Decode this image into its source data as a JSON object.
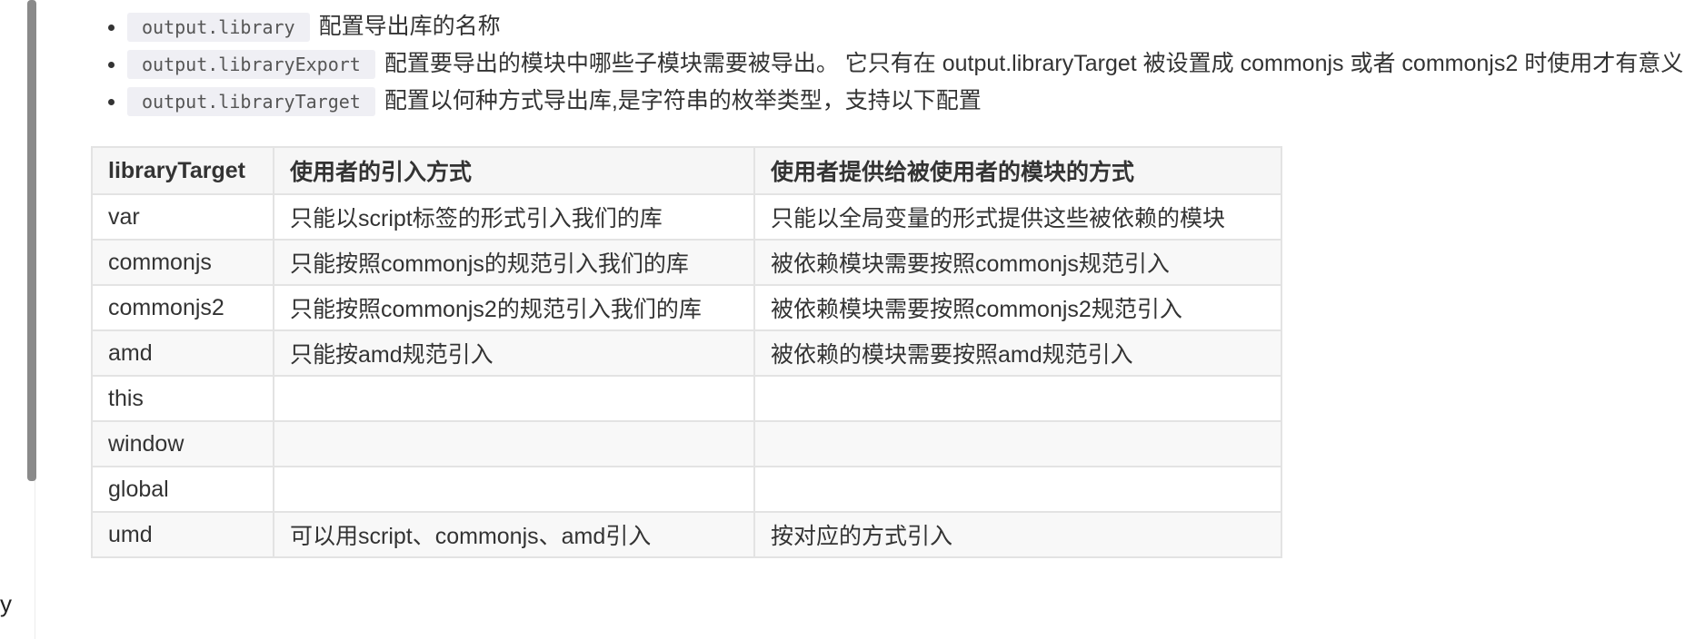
{
  "bullets": [
    {
      "code": "output.library",
      "text": "配置导出库的名称"
    },
    {
      "code": "output.libraryExport",
      "text": "配置要导出的模块中哪些子模块需要被导出。 它只有在 output.libraryTarget 被设置成 commonjs 或者 commonjs2 时使用才有意义"
    },
    {
      "code": "output.libraryTarget",
      "text": "配置以何种方式导出库,是字符串的枚举类型，支持以下配置"
    }
  ],
  "table": {
    "headers": [
      "libraryTarget",
      "使用者的引入方式",
      "使用者提供给被使用者的模块的方式"
    ],
    "rows": [
      [
        "var",
        "只能以script标签的形式引入我们的库",
        "只能以全局变量的形式提供这些被依赖的模块"
      ],
      [
        "commonjs",
        "只能按照commonjs的规范引入我们的库",
        "被依赖模块需要按照commonjs规范引入"
      ],
      [
        "commonjs2",
        "只能按照commonjs2的规范引入我们的库",
        "被依赖模块需要按照commonjs2规范引入"
      ],
      [
        "amd",
        "只能按amd规范引入",
        "被依赖的模块需要按照amd规范引入"
      ],
      [
        "this",
        "",
        ""
      ],
      [
        "window",
        "",
        ""
      ],
      [
        "global",
        "",
        ""
      ],
      [
        "umd",
        "可以用script、commonjs、amd引入",
        "按对应的方式引入"
      ]
    ]
  },
  "sidebar": {
    "fragment": "y"
  }
}
